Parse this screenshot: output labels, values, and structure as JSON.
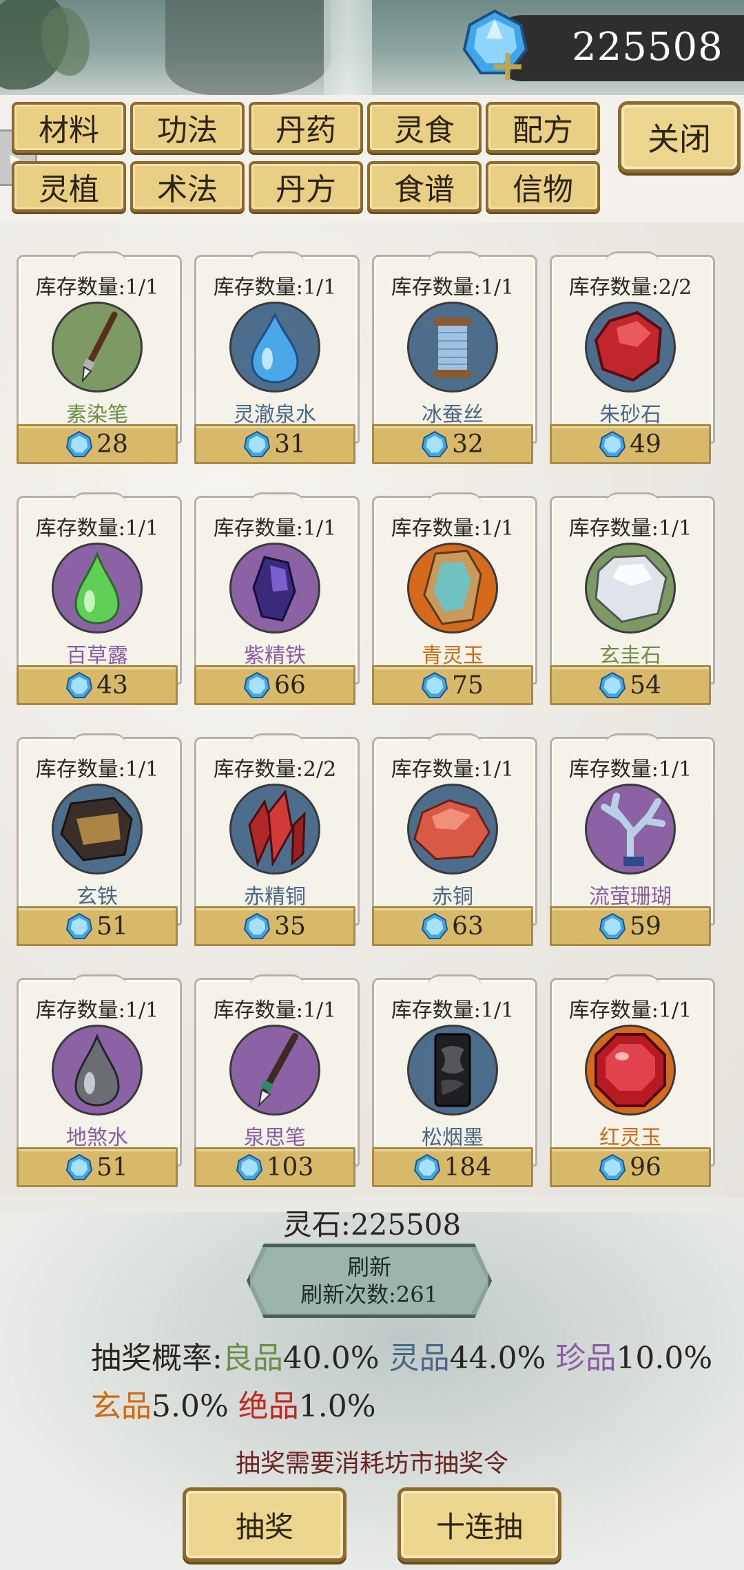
{
  "currency": {
    "amount": "225508",
    "icon": "spirit-stone-icon"
  },
  "tabs": [
    {
      "label": "材料"
    },
    {
      "label": "功法"
    },
    {
      "label": "丹药"
    },
    {
      "label": "灵食"
    },
    {
      "label": "配方"
    },
    {
      "label": "灵植"
    },
    {
      "label": "术法"
    },
    {
      "label": "丹方"
    },
    {
      "label": "食谱"
    },
    {
      "label": "信物"
    }
  ],
  "close_label": "关闭",
  "items": [
    {
      "stock": "库存数量:1/1",
      "name": "素染笔",
      "price": "28",
      "quality": "green",
      "icon": "brush-icon"
    },
    {
      "stock": "库存数量:1/1",
      "name": "灵澈泉水",
      "price": "31",
      "quality": "blue",
      "icon": "water-drop-icon"
    },
    {
      "stock": "库存数量:1/1",
      "name": "冰蚕丝",
      "price": "32",
      "quality": "blue",
      "icon": "silk-spool-icon"
    },
    {
      "stock": "库存数量:2/2",
      "name": "朱砂石",
      "price": "49",
      "quality": "blue",
      "icon": "red-ore-icon"
    },
    {
      "stock": "库存数量:1/1",
      "name": "百草露",
      "price": "43",
      "quality": "purple",
      "icon": "green-drop-icon"
    },
    {
      "stock": "库存数量:1/1",
      "name": "紫精铁",
      "price": "66",
      "quality": "purple",
      "icon": "purple-crystal-icon"
    },
    {
      "stock": "库存数量:1/1",
      "name": "青灵玉",
      "price": "75",
      "quality": "orange",
      "icon": "jade-ore-icon"
    },
    {
      "stock": "库存数量:1/1",
      "name": "玄圭石",
      "price": "54",
      "quality": "green",
      "icon": "white-stone-icon"
    },
    {
      "stock": "库存数量:1/1",
      "name": "玄铁",
      "price": "51",
      "quality": "blue",
      "icon": "dark-iron-icon"
    },
    {
      "stock": "库存数量:2/2",
      "name": "赤精铜",
      "price": "35",
      "quality": "blue",
      "icon": "red-crystal-icon"
    },
    {
      "stock": "库存数量:1/1",
      "name": "赤铜",
      "price": "63",
      "quality": "blue",
      "icon": "copper-ore-icon"
    },
    {
      "stock": "库存数量:1/1",
      "name": "流萤珊瑚",
      "price": "59",
      "quality": "purple",
      "icon": "coral-icon"
    },
    {
      "stock": "库存数量:1/1",
      "name": "地煞水",
      "price": "51",
      "quality": "purple",
      "icon": "grey-drop-icon"
    },
    {
      "stock": "库存数量:1/1",
      "name": "泉思笔",
      "price": "103",
      "quality": "purple",
      "icon": "pen-icon"
    },
    {
      "stock": "库存数量:1/1",
      "name": "松烟墨",
      "price": "184",
      "quality": "blue",
      "icon": "ink-stick-icon"
    },
    {
      "stock": "库存数量:1/1",
      "name": "红灵玉",
      "price": "96",
      "quality": "orange",
      "icon": "red-gem-icon"
    }
  ],
  "stone_total": "灵石:225508",
  "refresh": {
    "label": "刷新",
    "count": "刷新次数:261"
  },
  "odds": {
    "prefix": "抽奖概率:",
    "tiers": [
      {
        "name": "良品",
        "value": "40.0%",
        "color": "#6c8e46"
      },
      {
        "name": "灵品",
        "value": "44.0%",
        "color": "#4a6886"
      },
      {
        "name": "珍品",
        "value": "10.0%",
        "color": "#8a5ea0"
      },
      {
        "name": "玄品",
        "value": "5.0%",
        "color": "#cf6a10"
      },
      {
        "name": "绝品",
        "value": "1.0%",
        "color": "#c0271f"
      }
    ]
  },
  "notice": "抽奖需要消耗坊市抽奖令",
  "buttons": {
    "draw": "抽奖",
    "draw_ten": "十连抽"
  }
}
